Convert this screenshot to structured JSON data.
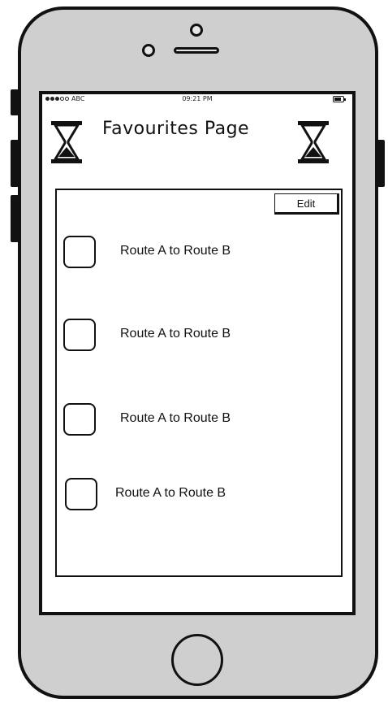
{
  "status_bar": {
    "carrier": "ABC",
    "time": "09:21 PM"
  },
  "header": {
    "title": "Favourites Page",
    "left_icon": "hourglass-icon",
    "right_icon": "hourglass-icon"
  },
  "favourites": {
    "edit_label": "Edit",
    "items": [
      {
        "label": "Route A to Route B"
      },
      {
        "label": "Route A to Route B"
      },
      {
        "label": "Route A to Route B"
      },
      {
        "label": "Route A to Route B"
      }
    ]
  },
  "colors": {
    "phone_body": "#cfcfcf",
    "stroke": "#111111",
    "screen": "#ffffff"
  }
}
